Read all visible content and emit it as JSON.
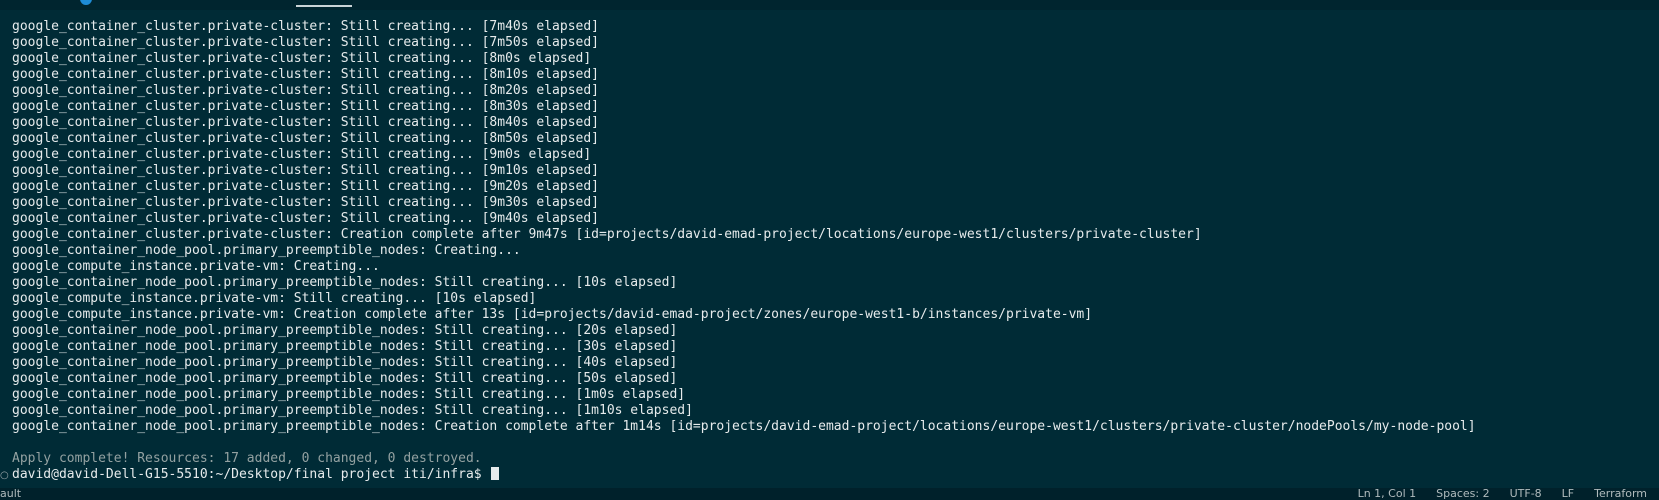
{
  "terminal": {
    "lines": [
      "google_container_cluster.private-cluster: Still creating... [7m40s elapsed]",
      "google_container_cluster.private-cluster: Still creating... [7m50s elapsed]",
      "google_container_cluster.private-cluster: Still creating... [8m0s elapsed]",
      "google_container_cluster.private-cluster: Still creating... [8m10s elapsed]",
      "google_container_cluster.private-cluster: Still creating... [8m20s elapsed]",
      "google_container_cluster.private-cluster: Still creating... [8m30s elapsed]",
      "google_container_cluster.private-cluster: Still creating... [8m40s elapsed]",
      "google_container_cluster.private-cluster: Still creating... [8m50s elapsed]",
      "google_container_cluster.private-cluster: Still creating... [9m0s elapsed]",
      "google_container_cluster.private-cluster: Still creating... [9m10s elapsed]",
      "google_container_cluster.private-cluster: Still creating... [9m20s elapsed]",
      "google_container_cluster.private-cluster: Still creating... [9m30s elapsed]",
      "google_container_cluster.private-cluster: Still creating... [9m40s elapsed]",
      "google_container_cluster.private-cluster: Creation complete after 9m47s [id=projects/david-emad-project/locations/europe-west1/clusters/private-cluster]",
      "google_container_node_pool.primary_preemptible_nodes: Creating...",
      "google_compute_instance.private-vm: Creating...",
      "google_container_node_pool.primary_preemptible_nodes: Still creating... [10s elapsed]",
      "google_compute_instance.private-vm: Still creating... [10s elapsed]",
      "google_compute_instance.private-vm: Creation complete after 13s [id=projects/david-emad-project/zones/europe-west1-b/instances/private-vm]",
      "google_container_node_pool.primary_preemptible_nodes: Still creating... [20s elapsed]",
      "google_container_node_pool.primary_preemptible_nodes: Still creating... [30s elapsed]",
      "google_container_node_pool.primary_preemptible_nodes: Still creating... [40s elapsed]",
      "google_container_node_pool.primary_preemptible_nodes: Still creating... [50s elapsed]",
      "google_container_node_pool.primary_preemptible_nodes: Still creating... [1m0s elapsed]",
      "google_container_node_pool.primary_preemptible_nodes: Still creating... [1m10s elapsed]",
      "google_container_node_pool.primary_preemptible_nodes: Creation complete after 1m14s [id=projects/david-emad-project/locations/europe-west1/clusters/private-cluster/nodePools/my-node-pool]"
    ],
    "apply_message": "Apply complete! Resources: 17 added, 0 changed, 0 destroyed.",
    "prompt": "david@david-Dell-G15-5510:~/Desktop/final project iti/infra$ "
  },
  "statusbar": {
    "left_text": "ault",
    "position": "Ln 1, Col 1",
    "spaces": "Spaces: 2",
    "encoding": "UTF-8",
    "eol": "LF",
    "language": "Terraform"
  },
  "colors": {
    "background": "#002b36",
    "text": "#e6ebec"
  }
}
